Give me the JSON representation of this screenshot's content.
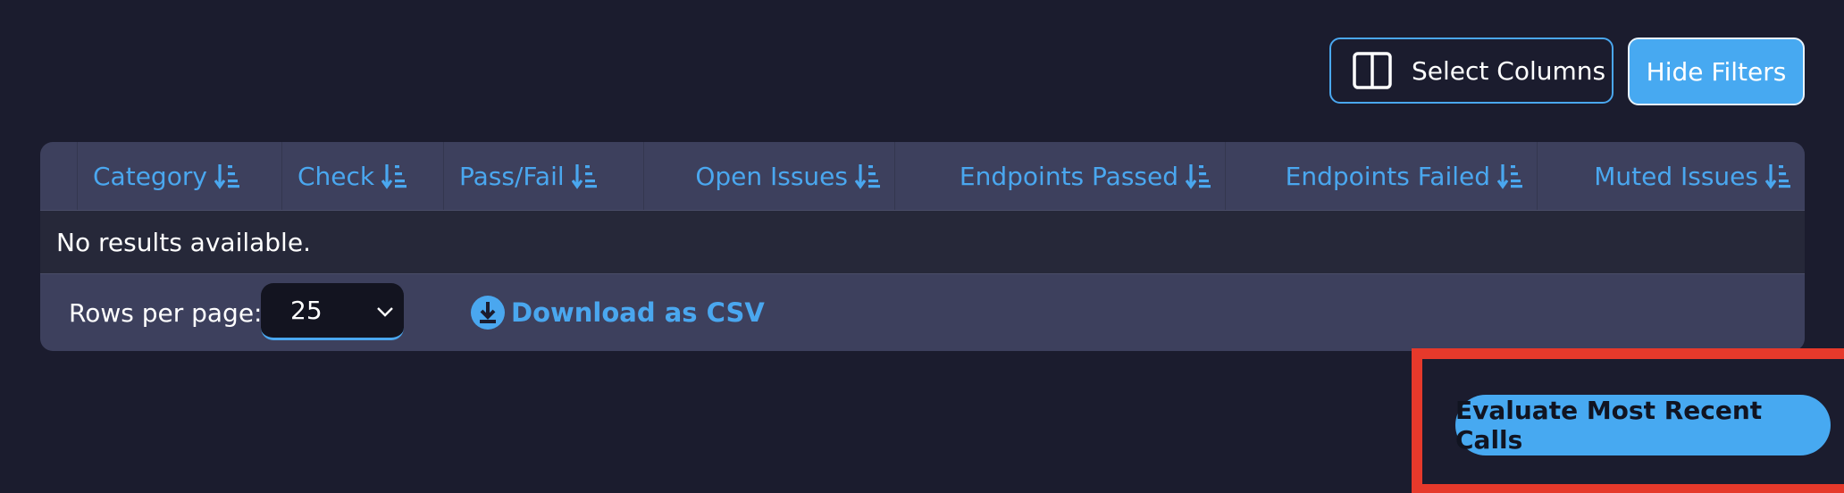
{
  "toolbar": {
    "select_columns_label": "Select Columns",
    "hide_filters_label": "Hide Filters",
    "select_columns_icon": "columns-icon"
  },
  "table": {
    "columns": [
      {
        "label": "Category",
        "align": "left"
      },
      {
        "label": "Check",
        "align": "left"
      },
      {
        "label": "Pass/Fail",
        "align": "left"
      },
      {
        "label": "Open Issues",
        "align": "right"
      },
      {
        "label": "Endpoints Passed",
        "align": "right"
      },
      {
        "label": "Endpoints Failed",
        "align": "right"
      },
      {
        "label": "Muted Issues",
        "align": "right"
      }
    ],
    "sort_icon": "sort-descending-icon",
    "empty_message": "No results available."
  },
  "footer": {
    "rows_per_page_label": "Rows per page:",
    "rows_per_page_value": "25",
    "download_label": "Download as CSV",
    "download_icon": "download-circle-icon"
  },
  "actions": {
    "evaluate_label": "Evaluate Most Recent Calls"
  },
  "colors": {
    "background": "#1b1c2e",
    "accent": "#47a9f1",
    "card": "#3d405d",
    "highlight": "#e6392b"
  }
}
